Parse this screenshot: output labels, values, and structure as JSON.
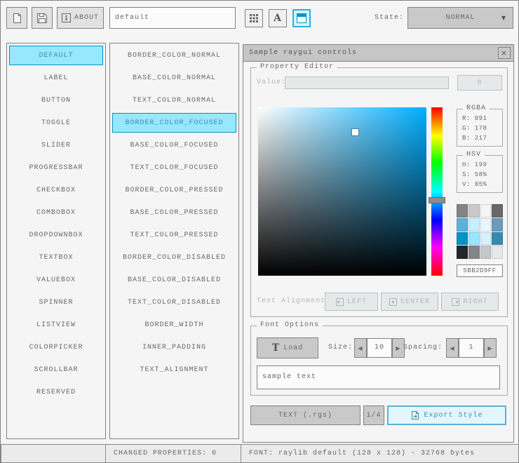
{
  "toolbar": {
    "about_label": "ABOUT",
    "style_name_value": "default",
    "state_label": "State:",
    "state_value": "NORMAL"
  },
  "icons": {
    "left_arrow": "◀",
    "right_arrow": "▶",
    "dropdown_arrow": "▼",
    "close": "×",
    "load_glyph": "T",
    "font_glyph": "A"
  },
  "controls_list": {
    "selected_index": 0,
    "items": [
      "DEFAULT",
      "LABEL",
      "BUTTON",
      "TOGGLE",
      "SLIDER",
      "PROGRESSBAR",
      "CHECKBOX",
      "COMBOBOX",
      "DROPDOWNBOX",
      "TEXTBOX",
      "VALUEBOX",
      "SPINNER",
      "LISTVIEW",
      "COLORPICKER",
      "SCROLLBAR",
      "RESERVED"
    ]
  },
  "properties_list": {
    "selected_index": 3,
    "items": [
      "BORDER_COLOR_NORMAL",
      "BASE_COLOR_NORMAL",
      "TEXT_COLOR_NORMAL",
      "BORDER_COLOR_FOCUSED",
      "BASE_COLOR_FOCUSED",
      "TEXT_COLOR_FOCUSED",
      "BORDER_COLOR_PRESSED",
      "BASE_COLOR_PRESSED",
      "TEXT_COLOR_PRESSED",
      "BORDER_COLOR_DISABLED",
      "BASE_COLOR_DISABLED",
      "TEXT_COLOR_DISABLED",
      "BORDER_WIDTH",
      "INNER_PADDING",
      "TEXT_ALIGNMENT"
    ]
  },
  "sample_window": {
    "title": "Sample raygui controls",
    "property_editor": {
      "group_label": "Property Editor",
      "value_label": "Value:",
      "value_text": "",
      "value_button_label": "0",
      "picker": {
        "hue": 199,
        "saturation_pct": 58,
        "value_pct": 85
      },
      "rgba_box": {
        "title": "RGBA",
        "lines": [
          "R: 091",
          "G: 178",
          "B: 217"
        ]
      },
      "hsv_box": {
        "title": "HSV",
        "lines": [
          "H: 199",
          "S: 58%",
          "V: 85%"
        ]
      },
      "palette": [
        "#838383",
        "#c9c9c9",
        "#f5f5f5",
        "#686868",
        "#5bb2d9",
        "#c9effe",
        "#eaf6fd",
        "#6c9bbc",
        "#0492c7",
        "#97e8ff",
        "#d5f1fc",
        "#368baf",
        "#24262b",
        "#82868b",
        "#c5c8ca",
        "#e6e9e9"
      ],
      "hex_value": "5BB2D9FF",
      "text_alignment_label": "Text Alignment:",
      "alignment_buttons": [
        "LEFT",
        "CENTER",
        "RIGHT"
      ]
    },
    "font_options": {
      "group_label": "Font Options",
      "load_button_label": "Load",
      "size_label": "Size:",
      "size_value": "10",
      "spacing_label": "Spacing:",
      "spacing_value": "1",
      "sample_text": "sample text"
    },
    "footer": {
      "save_button_label": "TEXT (.rgs)",
      "counter_label": "1/4",
      "export_button_label": "Export Style"
    }
  },
  "status_bar": {
    "left": "",
    "changed_properties": "CHANGED PROPERTIES: 0",
    "font_info": "FONT: raylib default (128 x 128) - 32768 bytes"
  },
  "colors": {
    "accent_border": "#0492c7",
    "accent_fill": "#97e8ff",
    "focus_border": "#5bb2d9",
    "selected_color": "#5bb2d9"
  }
}
